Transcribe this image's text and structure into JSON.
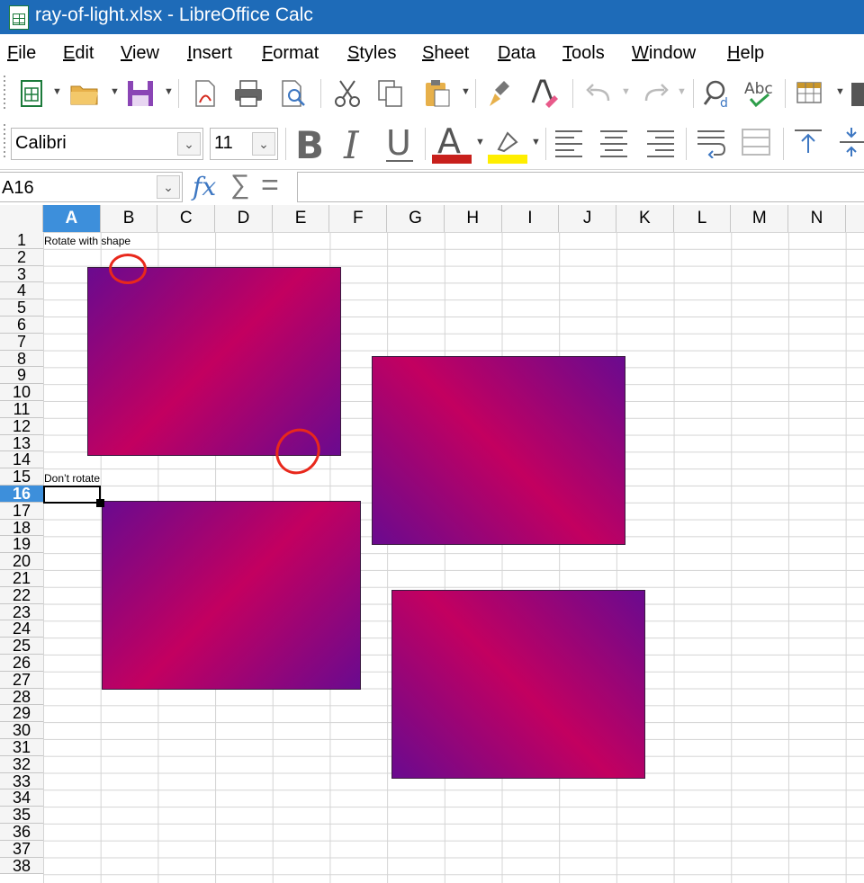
{
  "window": {
    "title": "ray-of-light.xlsx - LibreOffice Calc"
  },
  "menu": [
    "File",
    "Edit",
    "View",
    "Insert",
    "Format",
    "Styles",
    "Sheet",
    "Data",
    "Tools",
    "Window",
    "Help"
  ],
  "format_toolbar": {
    "font_name": "Calibri",
    "font_size": "11"
  },
  "formula_bar": {
    "cell_ref": "A16",
    "content": ""
  },
  "columns": [
    "A",
    "B",
    "C",
    "D",
    "E",
    "F",
    "G",
    "H",
    "I",
    "J",
    "K",
    "L",
    "M",
    "N"
  ],
  "selected_column": "A",
  "rows": [
    "1",
    "2",
    "3",
    "4",
    "5",
    "6",
    "7",
    "8",
    "9",
    "10",
    "11",
    "12",
    "13",
    "14",
    "15",
    "16",
    "17",
    "18",
    "19",
    "20",
    "21",
    "22",
    "23",
    "24",
    "25",
    "26",
    "27",
    "28",
    "29",
    "30",
    "31",
    "32",
    "33",
    "34",
    "35",
    "36",
    "37",
    "38"
  ],
  "selected_row": "16",
  "cells": {
    "a1": "Rotate with shape",
    "a15": "Don’t rotate"
  },
  "colors": {
    "titlebar": "#1e6bb8",
    "selection": "#3d8fdb",
    "gradient_purple": "#6a0a8f",
    "gradient_magenta": "#c30060",
    "annotation_red": "#e8281c"
  }
}
